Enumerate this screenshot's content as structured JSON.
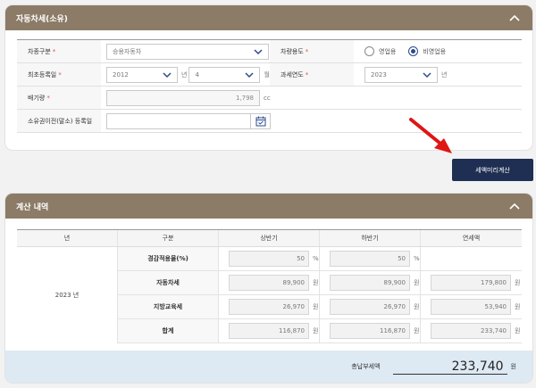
{
  "form_panel": {
    "title": "자동차세(소유)",
    "vehicle_type": {
      "label": "차종구분",
      "value": "승용자동차"
    },
    "usage": {
      "label": "차량용도",
      "options": [
        "영업용",
        "비영업용"
      ],
      "selected": "비영업용"
    },
    "first_reg": {
      "label": "최초등록일",
      "year": "2012",
      "year_unit": "년",
      "month": "4",
      "month_unit": "월"
    },
    "tax_year": {
      "label": "과세연도",
      "value": "2023",
      "unit": "년"
    },
    "displacement": {
      "label": "배기량",
      "value": "1,798",
      "unit": "cc"
    },
    "transfer_date": {
      "label": "소유권이전(말소) 등록일",
      "value": ""
    },
    "required_mark": "*"
  },
  "calc_button": {
    "label": "세액미리계산"
  },
  "result_panel": {
    "title": "계산 내역",
    "headers": [
      "년",
      "구분",
      "상반기",
      "하반기",
      "연세액"
    ],
    "year": "2023 년",
    "rows": [
      {
        "label": "경감적용율(%)",
        "h1": "50",
        "h2": "50",
        "annual": "",
        "unit": "%"
      },
      {
        "label": "자동차세",
        "h1": "89,900",
        "h2": "89,900",
        "annual": "179,800",
        "unit": "원"
      },
      {
        "label": "지방교육세",
        "h1": "26,970",
        "h2": "26,970",
        "annual": "53,940",
        "unit": "원"
      },
      {
        "label": "합계",
        "h1": "116,870",
        "h2": "116,870",
        "annual": "233,740",
        "unit": "원"
      }
    ],
    "total": {
      "label": "총납부세액",
      "value": "233,740",
      "unit": "원"
    }
  },
  "colors": {
    "header_bg": "#8c7b66",
    "button_bg": "#1e2f53",
    "total_bg": "#dde9f3",
    "arrow": "#e01515"
  },
  "icons": [
    "chevron-up-icon",
    "chevron-down-icon",
    "calendar-icon",
    "red-arrow-icon"
  ]
}
